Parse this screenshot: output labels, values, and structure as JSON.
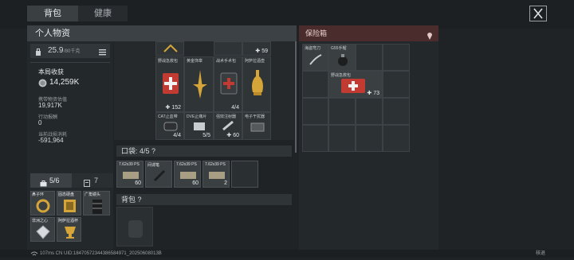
{
  "tabs": [
    {
      "label": "背包"
    },
    {
      "label": "健康"
    }
  ],
  "personal": {
    "title": "个人物资",
    "weight": "25.9",
    "weight_max": "/80千克",
    "session_title": "本局收获",
    "session_value": "14,259K",
    "stats": [
      {
        "label": "携带物资估值",
        "value": "19,917K"
      },
      {
        "label": "行动报酬",
        "value": "0"
      },
      {
        "label": "当前战损消耗",
        "value": "-591,964"
      }
    ]
  },
  "grid_items": [
    {
      "label": "野战急救包",
      "count": "152",
      "count_prefix": "✚"
    },
    {
      "label": "黄金饰章",
      "count": ""
    },
    {
      "label": "战术手术包",
      "count": "4/4"
    },
    {
      "label": "阿萨拉酒壶",
      "count": ""
    },
    {
      "label": "CAT止血带",
      "count": "4/4"
    },
    {
      "label": "DVE止痛片",
      "count": "5/5"
    },
    {
      "label": "强效注射器",
      "count": "60",
      "count_prefix": "✚"
    },
    {
      "label": "电子干扰器",
      "count": ""
    }
  ],
  "top_partial_count": "59",
  "pocket": {
    "title": "口袋: 4/5 ?"
  },
  "pocket_items": [
    {
      "label": "7.62x39 PS",
      "count": "60"
    },
    {
      "label": "间谍笔",
      "count": ""
    },
    {
      "label": "7.62x39 PS",
      "count": "60"
    },
    {
      "label": "7.62x39 PS",
      "count": "2"
    }
  ],
  "backpack": {
    "title": "背包 ?"
  },
  "bottom_tabs": {
    "items_count": "5/6",
    "other_count": "7"
  },
  "left_items": [
    {
      "label": "鼻子环"
    },
    {
      "label": "固态硬盘"
    },
    {
      "label": "广角镜头"
    },
    {
      "label": "非洲之心"
    },
    {
      "label": "阿萨拉酒杯"
    }
  ],
  "safe": {
    "title": "保险箱",
    "items": [
      {
        "label": "海盗弯刀"
      },
      {
        "label": "G55手榴"
      },
      {
        "label": "野战急救包",
        "count": "73"
      }
    ]
  },
  "footer": {
    "text": "107ms  CN UID:18470572344386584971_20250608013B",
    "right": "核退"
  },
  "colors": {
    "bg": "#1f2325",
    "safe_head": "#4a2c2d",
    "medkit": "#c23b33"
  },
  "icons": [
    "close-icon",
    "weight-icon",
    "list-icon",
    "coin-icon",
    "plus-icon",
    "wifi-icon",
    "pin-icon"
  ]
}
